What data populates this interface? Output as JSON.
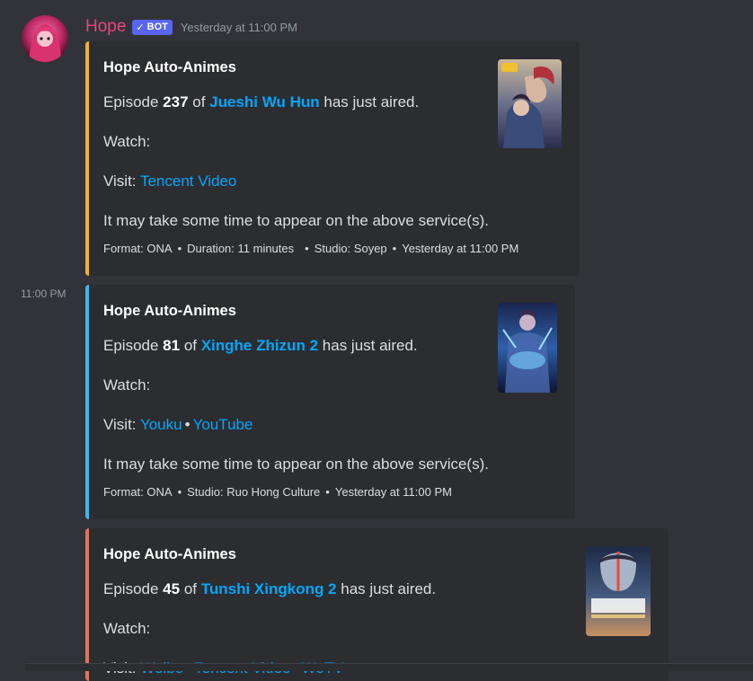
{
  "message": {
    "username": "Hope",
    "bot_badge": "BOT",
    "timestamp": "Yesterday at 11:00 PM",
    "side_timestamp": "11:00 PM"
  },
  "embeds": [
    {
      "title": "Hope Auto-Animes",
      "ep_prefix": "Episode ",
      "episode": "237",
      "ep_of": " of ",
      "series": "Jueshi Wu Hun",
      "ep_suffix": " has just aired.",
      "watch": "Watch:",
      "visit_label": "Visit: ",
      "links": [
        "Tencent Video"
      ],
      "note": "It may take some time to appear on the above service(s).",
      "footer": [
        "Format: ONA",
        "Duration: 11 minutes",
        "Studio: Soyep",
        "Yesterday at 11:00 PM"
      ],
      "accent": "#f0b132"
    },
    {
      "title": "Hope Auto-Animes",
      "ep_prefix": "Episode ",
      "episode": "81",
      "ep_of": " of ",
      "series": "Xinghe Zhizun 2",
      "ep_suffix": " has just aired.",
      "watch": "Watch:",
      "visit_label": "Visit: ",
      "links": [
        "Youku",
        "YouTube"
      ],
      "note": "It may take some time to appear on the above service(s).",
      "footer": [
        "Format: ONA",
        "Studio: Ruo Hong Culture",
        "Yesterday at 11:00 PM"
      ],
      "accent": "#3fb5f0"
    },
    {
      "title": "Hope Auto-Animes",
      "ep_prefix": "Episode ",
      "episode": "45",
      "ep_of": " of ",
      "series": "Tunshi Xingkong 2",
      "ep_suffix": " has just aired.",
      "watch": "Watch:",
      "visit_label": "Visit: ",
      "links": [
        "Weibo",
        "Tencent Video",
        "WeTV"
      ],
      "accent": "#e0745c"
    }
  ],
  "separator": "•"
}
